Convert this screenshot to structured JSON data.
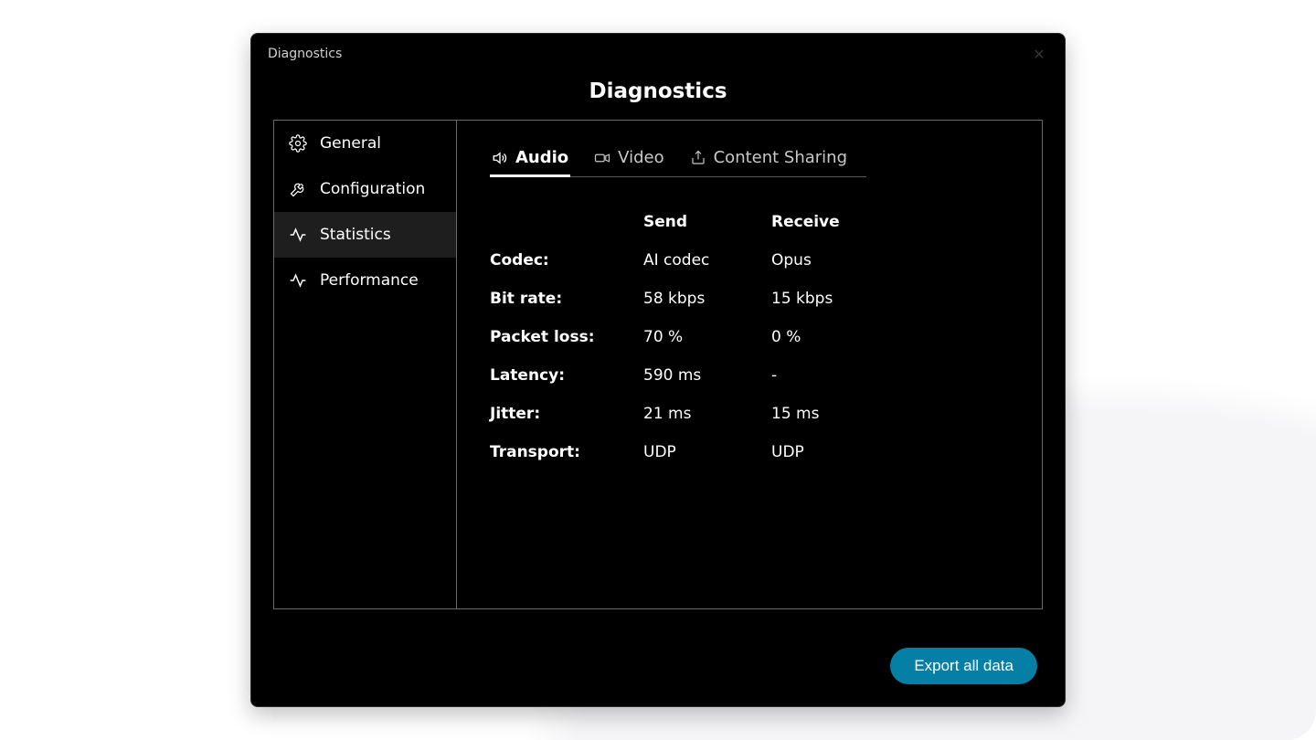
{
  "window": {
    "title": "Diagnostics"
  },
  "heading": "Diagnostics",
  "sidebar": {
    "items": [
      {
        "label": "General"
      },
      {
        "label": "Configuration"
      },
      {
        "label": "Statistics"
      },
      {
        "label": "Performance"
      }
    ],
    "active_index": 2
  },
  "tabs": {
    "items": [
      {
        "label": "Audio"
      },
      {
        "label": "Video"
      },
      {
        "label": "Content Sharing"
      }
    ],
    "active_index": 0
  },
  "stats": {
    "columns": {
      "send": "Send",
      "receive": "Receive"
    },
    "rows": [
      {
        "label": "Codec:",
        "send": "AI codec",
        "receive": "Opus"
      },
      {
        "label": "Bit rate:",
        "send": "58 kbps",
        "receive": "15 kbps"
      },
      {
        "label": "Packet loss:",
        "send": "70 %",
        "receive": "0 %"
      },
      {
        "label": "Latency:",
        "send": "590 ms",
        "receive": "-"
      },
      {
        "label": "Jitter:",
        "send": "21 ms",
        "receive": "15 ms"
      },
      {
        "label": "Transport:",
        "send": "UDP",
        "receive": "UDP"
      }
    ]
  },
  "footer": {
    "export_label": "Export all data"
  }
}
